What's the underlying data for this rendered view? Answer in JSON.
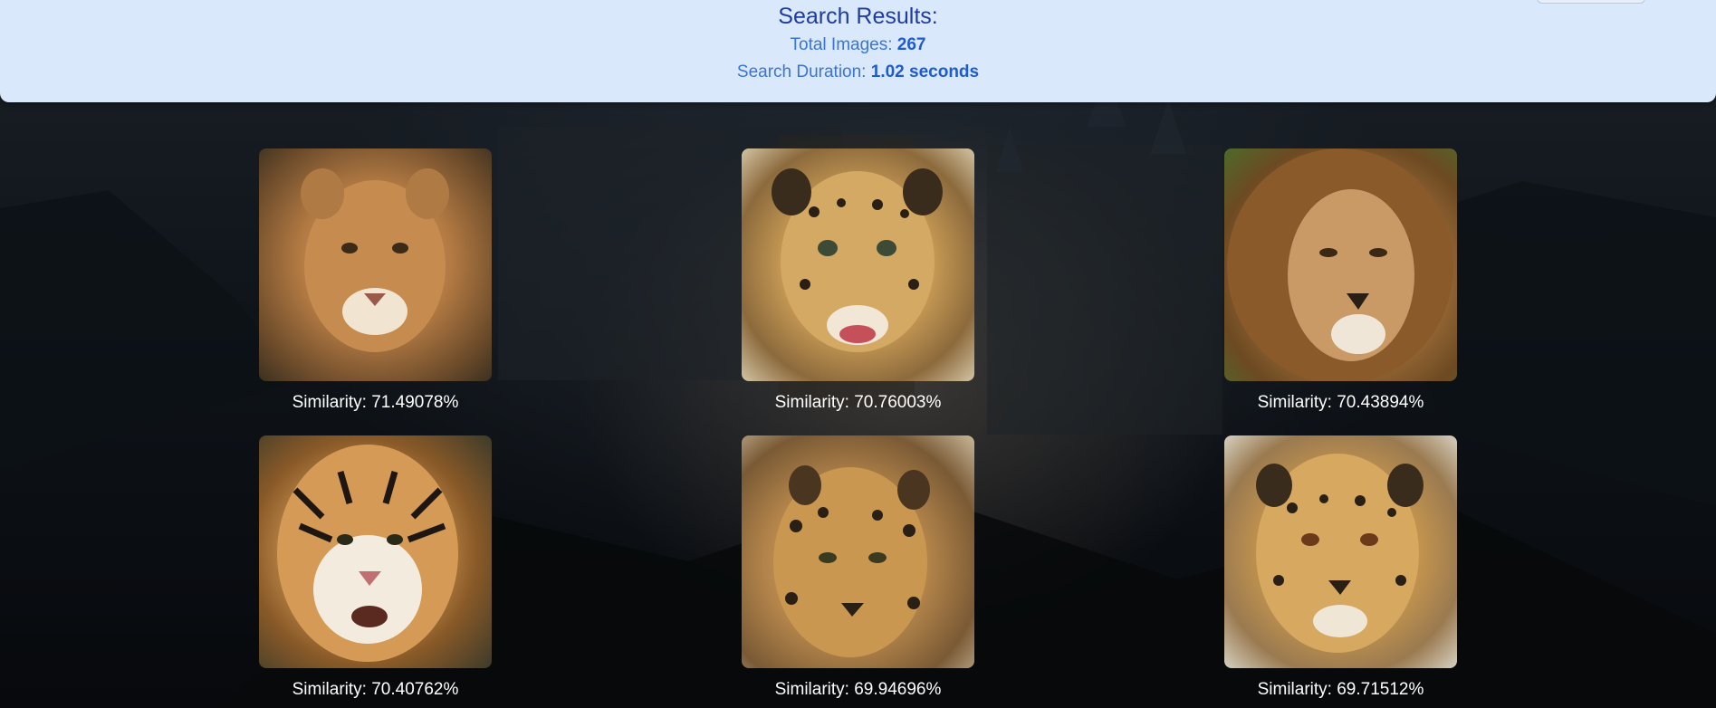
{
  "header": {
    "title": "Search Results:",
    "total_label": "Total Images: ",
    "total_value": "267",
    "duration_label": "Search Duration: ",
    "duration_value": "1.02 seconds"
  },
  "results": [
    {
      "animal": "lioness",
      "caption": "Similarity: 71.49078%"
    },
    {
      "animal": "jaguar",
      "caption": "Similarity: 70.76003%"
    },
    {
      "animal": "lion",
      "caption": "Similarity: 70.43894%"
    },
    {
      "animal": "tiger",
      "caption": "Similarity: 70.40762%"
    },
    {
      "animal": "jaguar",
      "caption": "Similarity: 69.94696%"
    },
    {
      "animal": "jaguar",
      "caption": "Similarity: 69.71512%"
    }
  ]
}
